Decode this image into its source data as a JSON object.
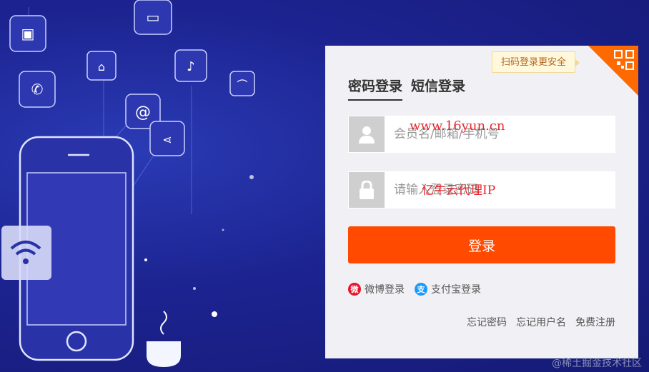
{
  "tips": {
    "qr": "扫码登录更安全"
  },
  "tabs": [
    {
      "label": "密码登录"
    },
    {
      "label": "短信登录"
    }
  ],
  "fields": {
    "username_placeholder": "会员名/邮箱/手机号",
    "password_placeholder": "请输入登录密码"
  },
  "watermarks": {
    "url": "www.16yun.cn",
    "proxy": "亿牛云代理IP"
  },
  "buttons": {
    "login": "登录"
  },
  "social": [
    {
      "label": "微博登录",
      "icon": "weibo-icon",
      "color": "#e6162d"
    },
    {
      "label": "支付宝登录",
      "icon": "alipay-icon",
      "color": "#1a9bfc"
    }
  ],
  "links": [
    "忘记密码",
    "忘记用户名",
    "免费注册"
  ],
  "credit": "@稀土掘金技术社区",
  "colors": {
    "accent": "#ff4a00",
    "background": "#1c2390",
    "panel": "#f1f1f5"
  }
}
